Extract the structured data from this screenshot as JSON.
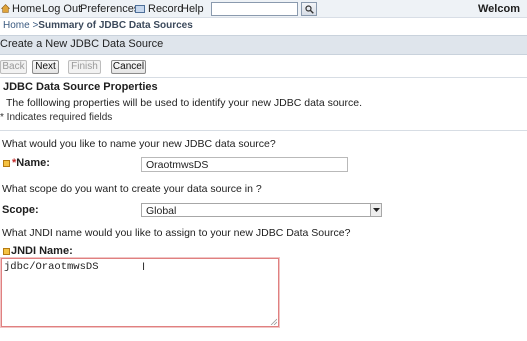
{
  "topnav": {
    "home": "Home",
    "logout": "Log Out",
    "preferences": "Preferences",
    "record": "Record",
    "help": "Help",
    "search_value": "",
    "welcome": "Welcom"
  },
  "breadcrumb": {
    "home": "Home >",
    "current": "Summary of JDBC Data Sources"
  },
  "page": {
    "title": "Create a New JDBC Data Source"
  },
  "buttons": {
    "back": "Back",
    "next": "Next",
    "finish": "Finish",
    "cancel": "Cancel"
  },
  "section": {
    "title": "JDBC Data Source Properties",
    "intro": "The folllowing properties will be used to identify your new JDBC data source.",
    "required_note": "* Indicates required fields"
  },
  "name_field": {
    "question": "What would you like to name your new JDBC data source?",
    "star": "*",
    "label": "Name:",
    "value": "OraotmwsDS"
  },
  "scope_field": {
    "question": "What scope do you want to create your data source in ?",
    "label": "Scope:",
    "value": "Global"
  },
  "jndi_field": {
    "question": "What JNDI name would you like to assign to your new JDBC Data Source?",
    "label": "JNDI Name:",
    "value": "jdbc/OraotmwsDS"
  },
  "colors": {
    "header_bg": "#dfe5ec",
    "topbar_bg": "#eef2f6",
    "required_star": "#c32b2b",
    "focus_border": "#e08080"
  },
  "icons": [
    "home-icon",
    "record-icon",
    "search-icon",
    "field-help-icon",
    "dropdown-arrow-icon",
    "text-cursor-icon",
    "resize-grip-icon"
  ]
}
